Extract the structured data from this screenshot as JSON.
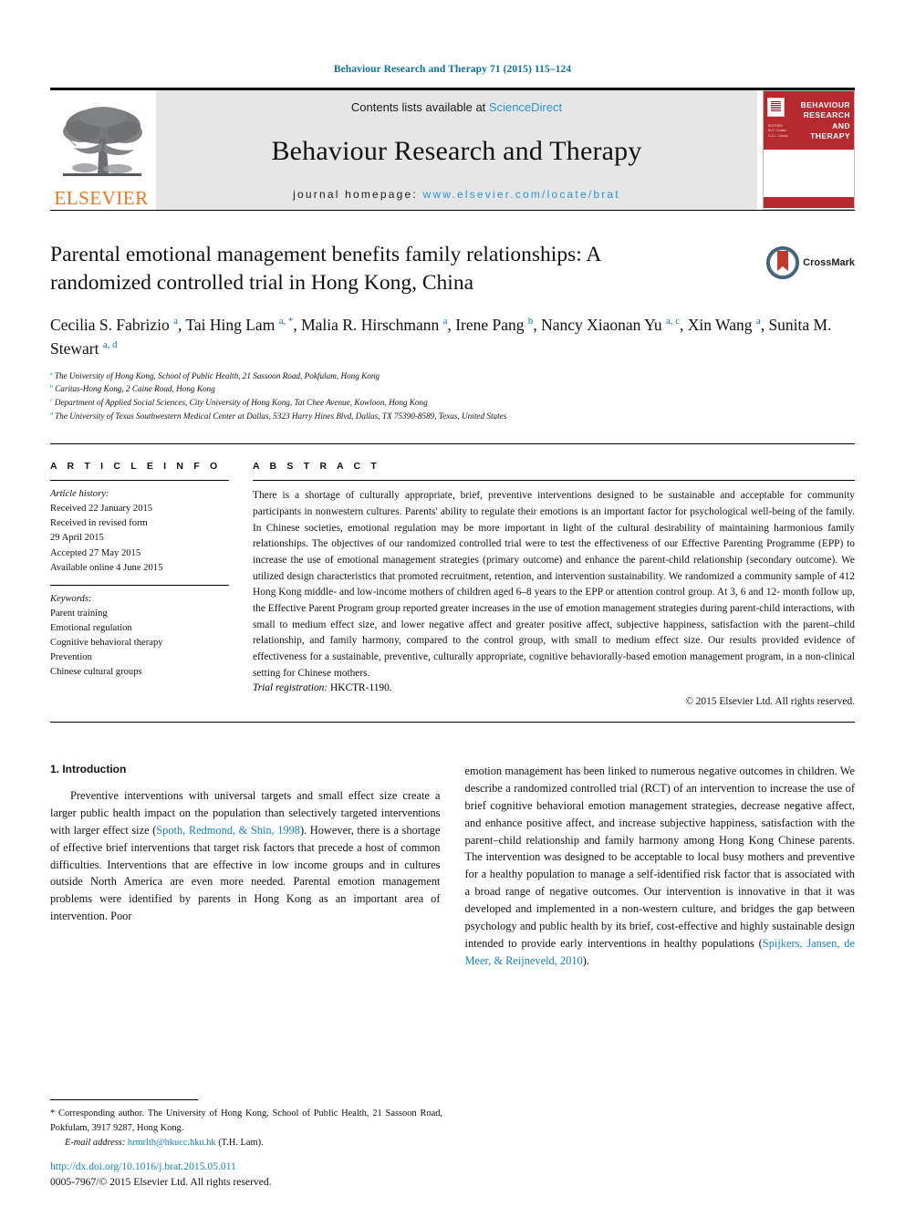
{
  "running_head": "Behaviour Research and Therapy 71 (2015) 115–124",
  "masthead": {
    "publisher_name": "ELSEVIER",
    "publisher_logo_icon": "elsevier-tree-logo",
    "contents_prefix": "Contents lists available at ",
    "contents_link": "ScienceDirect",
    "journal_name": "Behaviour Research and Therapy",
    "homepage_prefix": "journal homepage: ",
    "homepage_url": "www.elsevier.com/locate/brat",
    "cover_title_lines": [
      "BEHAVIOUR",
      "RESEARCH AND",
      "THERAPY"
    ],
    "cover_subtitle_lines": [
      "EDITORS",
      "M.G. Craske",
      "G.C.L. Davey"
    ]
  },
  "article": {
    "title": "Parental emotional management benefits family relationships: A randomized controlled trial in Hong Kong, China",
    "crossmark_label": "CrossMark",
    "crossmark_icon": "crossmark-badge-icon",
    "authors_html": "Cecilia S. Fabrizio <sup>a</sup>, Tai Hing Lam <sup>a, *</sup>, Malia R. Hirschmann <sup>a</sup>, Irene Pang <sup>b</sup>, Nancy Xiaonan Yu <sup>a, c</sup>, Xin Wang <sup>a</sup>, Sunita M. Stewart <sup>a, d</sup>",
    "affiliations": [
      {
        "marker": "a",
        "text": "The University of Hong Kong, School of Public Health, 21 Sassoon Road, Pokfulam, Hong Kong"
      },
      {
        "marker": "b",
        "text": "Caritas-Hong Kong, 2 Caine Road, Hong Kong"
      },
      {
        "marker": "c",
        "text": "Department of Applied Social Sciences, City University of Hong Kong, Tat Chee Avenue, Kowloon, Hong Kong"
      },
      {
        "marker": "d",
        "text": "The University of Texas Southwestern Medical Center at Dallas, 5323 Harry Hines Blvd, Dallas, TX 75390-8589, Texas, United States"
      }
    ]
  },
  "article_info": {
    "heading": "A R T I C L E   I N F O",
    "history_label": "Article history:",
    "history_lines": [
      "Received 22 January 2015",
      "Received in revised form",
      "29 April 2015",
      "Accepted 27 May 2015",
      "Available online 4 June 2015"
    ],
    "keywords_label": "Keywords:",
    "keywords": [
      "Parent training",
      "Emotional regulation",
      "Cognitive behavioral therapy",
      "Prevention",
      "Chinese cultural groups"
    ]
  },
  "abstract": {
    "heading": "A B S T R A C T",
    "body": "There is a shortage of culturally appropriate, brief, preventive interventions designed to be sustainable and acceptable for community participants in nonwestern cultures. Parents' ability to regulate their emotions is an important factor for psychological well-being of the family. In Chinese societies, emotional regulation may be more important in light of the cultural desirability of maintaining harmonious family relationships. The objectives of our randomized controlled trial were to test the effectiveness of our Effective Parenting Programme (EPP) to increase the use of emotional management strategies (primary outcome) and enhance the parent-child relationship (secondary outcome). We utilized design characteristics that promoted recruitment, retention, and intervention sustainability. We randomized a community sample of 412 Hong Kong middle- and low-income mothers of children aged 6–8 years to the EPP or attention control group. At 3, 6 and 12- month follow up, the Effective Parent Program group reported greater increases in the use of emotion management strategies during parent-child interactions, with small to medium effect size, and lower negative affect and greater positive affect, subjective happiness, satisfaction with the parent–child relationship, and family harmony, compared to the control group, with small to medium effect size. Our results provided evidence of effectiveness for a sustainable, preventive, culturally appropriate, cognitive behaviorally-based emotion management program, in a non-clinical setting for Chinese mothers.",
    "trial_registration_label": "Trial registration:",
    "trial_registration_value": "HKCTR-1190.",
    "copyright": "© 2015 Elsevier Ltd. All rights reserved."
  },
  "introduction": {
    "section_number_title": "1. Introduction",
    "left_paragraph_part1": "Preventive interventions with universal targets and small effect size create a larger public health impact on the population than selectively targeted interventions with larger effect size (",
    "left_citation1": "Spoth, Redmond, & Shin, 1998",
    "left_paragraph_part2": "). However, there is a shortage of effective brief interventions that target risk factors that precede a host of common difficulties. Interventions that are effective in low income groups and in cultures outside North America are even more needed. Parental emotion management problems were identified by parents in Hong Kong as an important area of intervention. Poor",
    "right_paragraph_part1": "emotion management has been linked to numerous negative outcomes in children. We describe a randomized controlled trial (RCT) of an intervention to increase the use of brief cognitive behavioral emotion management strategies, decrease negative affect, and enhance positive affect, and increase subjective happiness, satisfaction with the parent–child relationship and family harmony among Hong Kong Chinese parents. The intervention was designed to be acceptable to local busy mothers and preventive for a healthy population to manage a self-identified risk factor that is associated with a broad range of negative outcomes. Our intervention is innovative in that it was developed and implemented in a non-western culture, and bridges the gap between psychology and public health by its brief, cost-effective and highly sustainable design intended to provide early interventions in healthy populations (",
    "right_citation1": "Spijkers, Jansen, de Meer, & Reijneveld, 2010",
    "right_paragraph_part2": ")."
  },
  "footnotes": {
    "corresponding": "* Corresponding author. The University of Hong Kong, School of Public Health, 21 Sassoon Road, Pokfulam, 3917 9287, Hong Kong.",
    "email_label": "E-mail address:",
    "email_value": "hrmrlth@hkucc.hku.hk",
    "email_owner": "(T.H. Lam).",
    "doi_url": "http://dx.doi.org/10.1016/j.brat.2015.05.011",
    "issn_line": "0005-7967/© 2015 Elsevier Ltd. All rights reserved."
  },
  "colors": {
    "link_blue": "#1480c4",
    "running_head_blue": "#0b72a8",
    "elsevier_orange": "#E87722",
    "cover_red": "#b5292f",
    "band_gray": "#e6e6e6"
  }
}
